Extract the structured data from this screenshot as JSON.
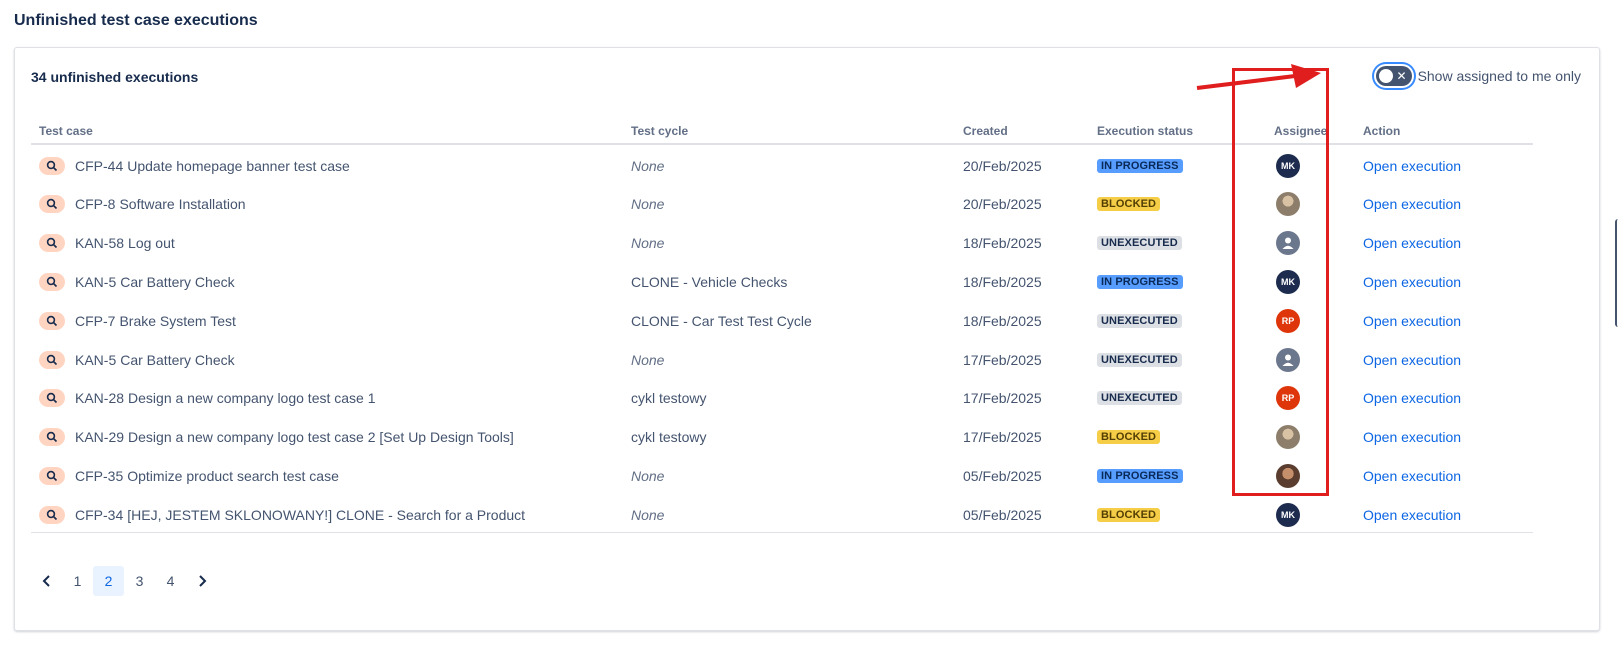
{
  "page": {
    "title": "Unfinished test case executions"
  },
  "panel": {
    "count_label": "34 unfinished executions",
    "toggle": {
      "label": "Show assigned to me only",
      "checked": false,
      "off_glyph": "✕"
    }
  },
  "table": {
    "headers": {
      "test_case": "Test case",
      "test_cycle": "Test cycle",
      "created": "Created",
      "execution_status": "Execution status",
      "assignee": "Assignee",
      "action": "Action"
    },
    "rows": [
      {
        "key": "CFP-44",
        "name": "Update homepage banner test case",
        "cycle": "None",
        "cycle_none": true,
        "created": "20/Feb/2025",
        "status": "IN PROGRESS",
        "status_kind": "in_progress",
        "assignee": {
          "initials": "MK",
          "style": "navy"
        },
        "action": "Open execution"
      },
      {
        "key": "CFP-8",
        "name": "Software Installation",
        "cycle": "None",
        "cycle_none": true,
        "created": "20/Feb/2025",
        "status": "BLOCKED",
        "status_kind": "blocked",
        "assignee": {
          "initials": "",
          "style": "photo1"
        },
        "action": "Open execution"
      },
      {
        "key": "KAN-58",
        "name": "Log out",
        "cycle": "None",
        "cycle_none": true,
        "created": "18/Feb/2025",
        "status": "UNEXECUTED",
        "status_kind": "unexecuted",
        "assignee": {
          "initials": "",
          "style": "grey"
        },
        "action": "Open execution"
      },
      {
        "key": "KAN-5",
        "name": "Car Battery Check",
        "cycle": "CLONE - Vehicle Checks",
        "cycle_none": false,
        "created": "18/Feb/2025",
        "status": "IN PROGRESS",
        "status_kind": "in_progress",
        "assignee": {
          "initials": "MK",
          "style": "navy"
        },
        "action": "Open execution"
      },
      {
        "key": "CFP-7",
        "name": "Brake System Test",
        "cycle": "CLONE - Car Test Test Cycle",
        "cycle_none": false,
        "created": "18/Feb/2025",
        "status": "UNEXECUTED",
        "status_kind": "unexecuted",
        "assignee": {
          "initials": "RP",
          "style": "red"
        },
        "action": "Open execution"
      },
      {
        "key": "KAN-5",
        "name": "Car Battery Check",
        "cycle": "None",
        "cycle_none": true,
        "created": "17/Feb/2025",
        "status": "UNEXECUTED",
        "status_kind": "unexecuted",
        "assignee": {
          "initials": "",
          "style": "grey"
        },
        "action": "Open execution"
      },
      {
        "key": "KAN-28",
        "name": "Design a new company logo test case 1",
        "cycle": "cykl testowy",
        "cycle_none": false,
        "created": "17/Feb/2025",
        "status": "UNEXECUTED",
        "status_kind": "unexecuted",
        "assignee": {
          "initials": "RP",
          "style": "red"
        },
        "action": "Open execution"
      },
      {
        "key": "KAN-29",
        "name": "Design a new company logo test case 2 [Set Up Design Tools]",
        "cycle": "cykl testowy",
        "cycle_none": false,
        "created": "17/Feb/2025",
        "status": "BLOCKED",
        "status_kind": "blocked",
        "assignee": {
          "initials": "",
          "style": "photo1"
        },
        "action": "Open execution"
      },
      {
        "key": "CFP-35",
        "name": "Optimize product search test case",
        "cycle": "None",
        "cycle_none": true,
        "created": "05/Feb/2025",
        "status": "IN PROGRESS",
        "status_kind": "in_progress",
        "assignee": {
          "initials": "",
          "style": "photo2"
        },
        "action": "Open execution"
      },
      {
        "key": "CFP-34",
        "name": "[HEJ, JESTEM SKLONOWANY!] CLONE - Search for a Product",
        "cycle": "None",
        "cycle_none": true,
        "created": "05/Feb/2025",
        "status": "BLOCKED",
        "status_kind": "blocked",
        "assignee": {
          "initials": "MK",
          "style": "navy"
        },
        "action": "Open execution"
      }
    ]
  },
  "pagination": {
    "pages": [
      "1",
      "2",
      "3",
      "4"
    ],
    "current": "2"
  },
  "icons": {
    "test_case": "magnifier-icon",
    "prev": "chevron-left-icon",
    "next": "chevron-right-icon",
    "default_avatar": "person-icon"
  },
  "colors": {
    "annotation": "#e01e1e",
    "link": "#0c66e4",
    "in_progress": "#579dff",
    "blocked": "#f5cd47",
    "unexecuted": "#dcdfe4"
  }
}
